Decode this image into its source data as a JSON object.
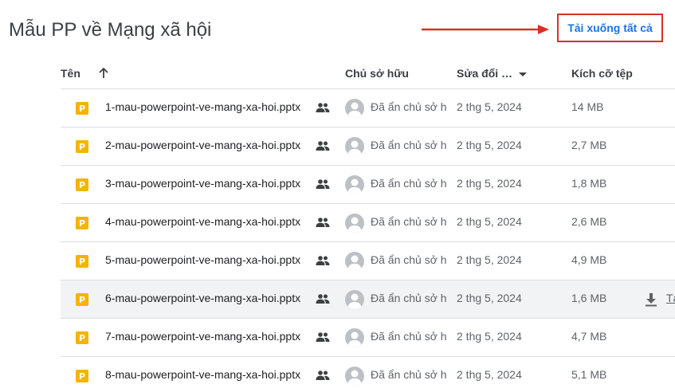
{
  "folder_title": "Mẫu PP về Mạng xã hội",
  "download_all_label": "Tải xuống tất cả",
  "columns": {
    "name": "Tên",
    "owner": "Chủ sở hữu",
    "modified": "Sửa đổi …",
    "size": "Kích cỡ tệp"
  },
  "file_type_letter": "P",
  "files": [
    {
      "name": "1-mau-powerpoint-ve-mang-xa-hoi.pptx",
      "owner": "Đã ẩn chủ sở hữu",
      "modified": "2 thg 5, 2024",
      "size": "14 MB"
    },
    {
      "name": "2-mau-powerpoint-ve-mang-xa-hoi.pptx",
      "owner": "Đã ẩn chủ sở hữu",
      "modified": "2 thg 5, 2024",
      "size": "2,7 MB"
    },
    {
      "name": "3-mau-powerpoint-ve-mang-xa-hoi.pptx",
      "owner": "Đã ẩn chủ sở hữu",
      "modified": "2 thg 5, 2024",
      "size": "1,8 MB"
    },
    {
      "name": "4-mau-powerpoint-ve-mang-xa-hoi.pptx",
      "owner": "Đã ẩn chủ sở hữu",
      "modified": "2 thg 5, 2024",
      "size": "2,6 MB"
    },
    {
      "name": "5-mau-powerpoint-ve-mang-xa-hoi.pptx",
      "owner": "Đã ẩn chủ sở hữu",
      "modified": "2 thg 5, 2024",
      "size": "4,9 MB"
    },
    {
      "name": "6-mau-powerpoint-ve-mang-xa-hoi.pptx",
      "owner": "Đã ẩn chủ sở hữu",
      "modified": "2 thg 5, 2024",
      "size": "1,6 MB",
      "hover": true,
      "row_download_label": "Tải xuống"
    },
    {
      "name": "7-mau-powerpoint-ve-mang-xa-hoi.pptx",
      "owner": "Đã ẩn chủ sở hữu",
      "modified": "2 thg 5, 2024",
      "size": "4,7 MB"
    },
    {
      "name": "8-mau-powerpoint-ve-mang-xa-hoi.pptx",
      "owner": "Đã ẩn chủ sở hữu",
      "modified": "2 thg 5, 2024",
      "size": "5,1 MB"
    }
  ],
  "colors": {
    "accent": "#1a73e8",
    "annotation_red": "#d93025",
    "slides_yellow": "#f4b400",
    "hover_row": "#f1f3f4"
  },
  "icons": {
    "sort": "arrow-up-icon",
    "shared": "people-icon",
    "avatar": "person-avatar-icon",
    "row_download": "download-icon"
  }
}
